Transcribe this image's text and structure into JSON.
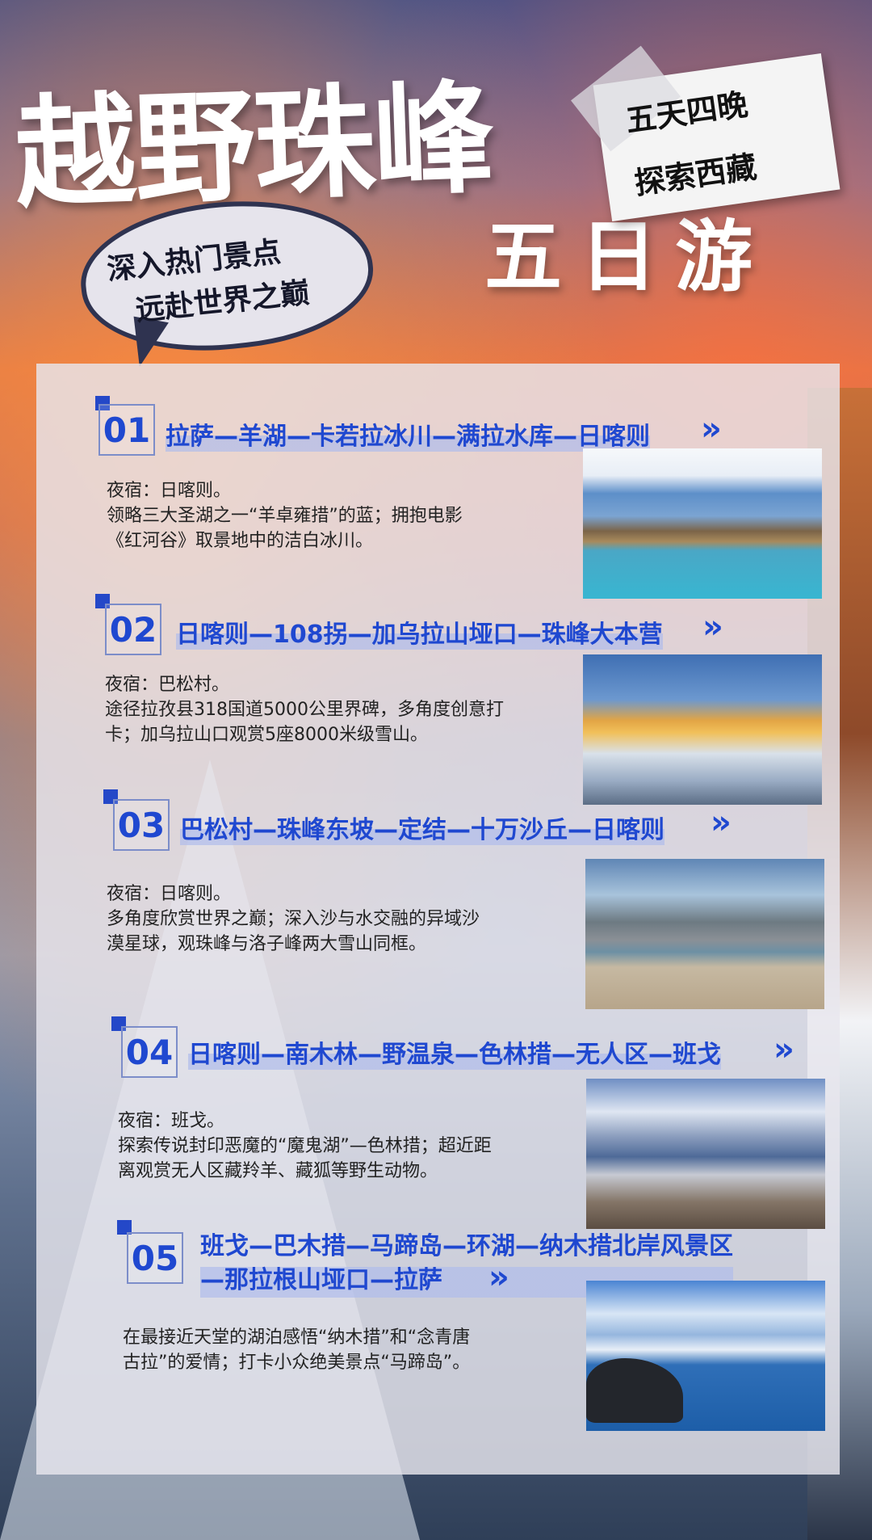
{
  "title": "越野珠峰",
  "subtitle_days": "五日游",
  "tag_lines": [
    "五天四晚",
    "探索西藏"
  ],
  "bubble_lines": [
    "深入热门景点",
    "远赴世界之巅"
  ],
  "days": [
    {
      "num": "01",
      "route": "拉萨—羊湖—卡若拉冰川—满拉水库—日喀则",
      "desc": [
        "夜宿：日喀则。",
        "领略三大圣湖之一“羊卓雍措”的蓝；拥抱电影",
        "《红河谷》取景地中的洁白冰川。"
      ]
    },
    {
      "num": "02",
      "route": "日喀则—108拐—加乌拉山垭口—珠峰大本营",
      "desc": [
        "夜宿：巴松村。",
        "途径拉孜县318国道5000公里界碑，多角度创意打",
        "卡；加乌拉山口观赏5座8000米级雪山。"
      ]
    },
    {
      "num": "03",
      "route": "巴松村—珠峰东坡—定结—十万沙丘—日喀则",
      "desc": [
        "夜宿：日喀则。",
        "多角度欣赏世界之巅；深入沙与水交融的异域沙",
        "漠星球，观珠峰与洛子峰两大雪山同框。"
      ]
    },
    {
      "num": "04",
      "route": "日喀则—南木林—野温泉—色林措—无人区—班戈",
      "desc": [
        "夜宿：班戈。",
        "探索传说封印恶魔的“魔鬼湖”—色林措；超近距",
        "离观赏无人区藏羚羊、藏狐等野生动物。"
      ]
    },
    {
      "num": "05",
      "route_lines": [
        "班戈—巴木措—马蹄岛—环湖—纳木措北岸风景区",
        "—那拉根山垭口—拉萨"
      ],
      "desc": [
        "在最接近天堂的湖泊感悟“纳木措”和“念青唐",
        "古拉”的爱情；打卡小众绝美景点“马蹄岛”。"
      ]
    }
  ],
  "chevron": "»"
}
